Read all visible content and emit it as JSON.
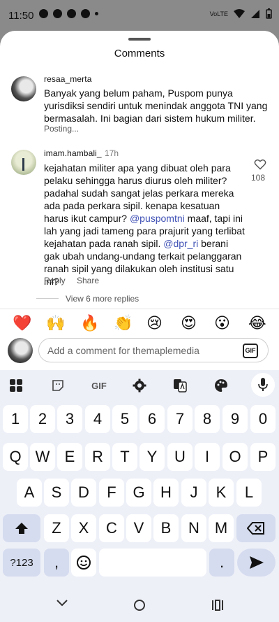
{
  "status_bar": {
    "time": "11:50",
    "network": "VoLTE"
  },
  "sheet": {
    "title": "Comments"
  },
  "comments": [
    {
      "username": "resaa_merta",
      "text": "Banyak yang belum paham, Puspom punya yurisdiksi sendiri untuk menindak anggota TNI yang bermasalah. Ini bagian dari sistem hukum militer.",
      "status": "Posting..."
    },
    {
      "username": "imam.hambali_",
      "time": "17h",
      "text_part1": "kejahatan militer apa yang dibuat oleh para pelaku sehingga harus diurus oleh militer? padahal sudah sangat jelas perkara mereka ada pada perkara sipil. kenapa kesatuan harus ikut campur? ",
      "mention1": "@puspomtni",
      "text_part2": " maaf, tapi ini lah yang jadi tameng para prajurit yang terlibat kejahatan pada ranah sipil. ",
      "mention2": "@dpr_ri",
      "text_part3": " berani gak ubah undang-undang terkait pelanggaran ranah sipil yang dilakukan oleh institusi satu ini?",
      "likes": "108",
      "reply_label": "Reply",
      "share_label": "Share",
      "view_replies": "View 6 more replies"
    }
  ],
  "emoji_bar": [
    "❤️",
    "🙌",
    "🔥",
    "👏",
    "😢",
    "😍",
    "😮",
    "😂"
  ],
  "composer": {
    "placeholder": "Add a comment for themaplemedia",
    "gif_label": "GIF"
  },
  "keyboard": {
    "tools": {
      "gif": "GIF"
    },
    "number_row": [
      "1",
      "2",
      "3",
      "4",
      "5",
      "6",
      "7",
      "8",
      "9",
      "0"
    ],
    "row1": [
      "Q",
      "W",
      "E",
      "R",
      "T",
      "Y",
      "U",
      "I",
      "O",
      "P"
    ],
    "row2": [
      "A",
      "S",
      "D",
      "F",
      "G",
      "H",
      "J",
      "K",
      "L"
    ],
    "row3": [
      "Z",
      "X",
      "C",
      "V",
      "B",
      "N",
      "M"
    ],
    "symbols_key": "?123",
    "comma_key": ",",
    "period_key": "."
  }
}
